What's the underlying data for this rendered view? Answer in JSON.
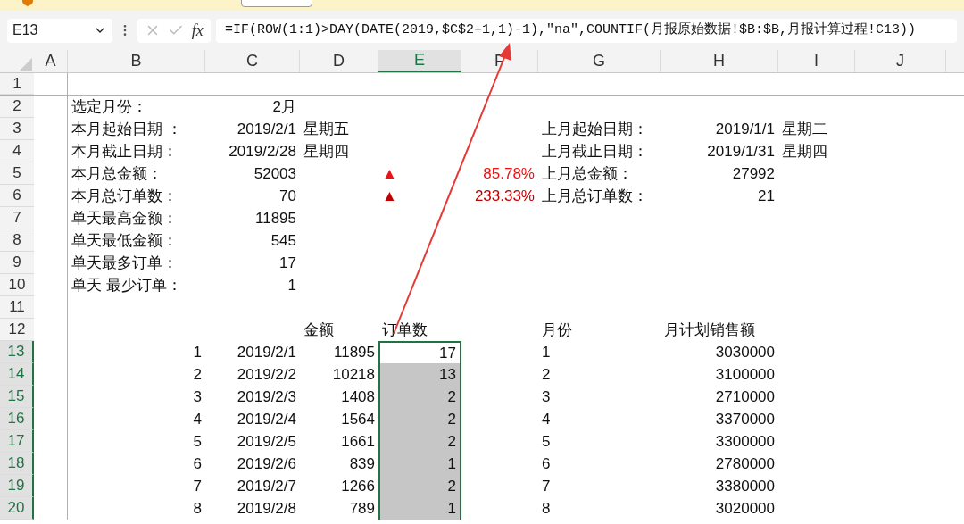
{
  "name_box": "E13",
  "fx_label": "fx",
  "formula": "=IF(ROW(1:1)>DAY(DATE(2019,$C$2+1,1)-1),\"na\",COUNTIF(月报原始数据!$B:$B,月报计算过程!C13))",
  "columns": [
    {
      "label": "A",
      "selected": false
    },
    {
      "label": "B",
      "selected": false
    },
    {
      "label": "C",
      "selected": false
    },
    {
      "label": "D",
      "selected": false
    },
    {
      "label": "E",
      "selected": true
    },
    {
      "label": "F",
      "selected": false
    },
    {
      "label": "G",
      "selected": false
    },
    {
      "label": "H",
      "selected": false
    },
    {
      "label": "I",
      "selected": false
    },
    {
      "label": "J",
      "selected": false
    }
  ],
  "row_headers": [
    {
      "label": "1",
      "selected": false
    },
    {
      "label": "2",
      "selected": false
    },
    {
      "label": "3",
      "selected": false
    },
    {
      "label": "4",
      "selected": false
    },
    {
      "label": "5",
      "selected": false
    },
    {
      "label": "6",
      "selected": false
    },
    {
      "label": "7",
      "selected": false
    },
    {
      "label": "8",
      "selected": false
    },
    {
      "label": "9",
      "selected": false
    },
    {
      "label": "10",
      "selected": false
    },
    {
      "label": "11",
      "selected": false
    },
    {
      "label": "12",
      "selected": false
    },
    {
      "label": "13",
      "selected": true
    },
    {
      "label": "14",
      "selected": true
    },
    {
      "label": "15",
      "selected": true
    },
    {
      "label": "16",
      "selected": true
    },
    {
      "label": "17",
      "selected": true
    },
    {
      "label": "18",
      "selected": true
    },
    {
      "label": "19",
      "selected": true
    },
    {
      "label": "20",
      "selected": true
    }
  ],
  "summary": [
    {
      "label": "选定月份：",
      "value": "2月"
    },
    {
      "label": "本月起始日期 ：",
      "value": "2019/2/1",
      "weekday": "星期五"
    },
    {
      "label": "本月截止日期：",
      "value": "2019/2/28",
      "weekday": "星期四"
    },
    {
      "label": "本月总金额：",
      "value": "52003"
    },
    {
      "label": "本月总订单数：",
      "value": "70"
    },
    {
      "label": "单天最高金额：",
      "value": "11895"
    },
    {
      "label": "单天最低金额：",
      "value": "545"
    },
    {
      "label": "单天最多订单：",
      "value": "17"
    },
    {
      "label": "单天 最少订单：",
      "value": "1"
    }
  ],
  "change": [
    {
      "arrow": "▲",
      "percent": "85.78%",
      "color": "#ee1111"
    },
    {
      "arrow": "▲",
      "percent": "233.33%",
      "color": "#c00000"
    }
  ],
  "previous_month": [
    {
      "label": "上月起始日期：",
      "value": "2019/1/1",
      "weekday": "星期二"
    },
    {
      "label": "上月截止日期：",
      "value": "2019/1/31",
      "weekday": "星期四"
    },
    {
      "label": "上月总金额：",
      "value": "27992"
    },
    {
      "label": "上月总订单数：",
      "value": "21"
    }
  ],
  "daily_table": {
    "columns": [
      "金额",
      "订单数"
    ],
    "rows": [
      {
        "index": "1",
        "date": "2019/2/1",
        "amount": "11895",
        "orders": "17",
        "selected": true,
        "active": true
      },
      {
        "index": "2",
        "date": "2019/2/2",
        "amount": "10218",
        "orders": "13",
        "selected": true,
        "active": false
      },
      {
        "index": "3",
        "date": "2019/2/3",
        "amount": "1408",
        "orders": "2",
        "selected": true,
        "active": false
      },
      {
        "index": "4",
        "date": "2019/2/4",
        "amount": "1564",
        "orders": "2",
        "selected": true,
        "active": false
      },
      {
        "index": "5",
        "date": "2019/2/5",
        "amount": "1661",
        "orders": "2",
        "selected": true,
        "active": false
      },
      {
        "index": "6",
        "date": "2019/2/6",
        "amount": "839",
        "orders": "1",
        "selected": true,
        "active": false
      },
      {
        "index": "7",
        "date": "2019/2/7",
        "amount": "1266",
        "orders": "2",
        "selected": true,
        "active": false
      },
      {
        "index": "8",
        "date": "2019/2/8",
        "amount": "789",
        "orders": "1",
        "selected": true,
        "active": false
      }
    ]
  },
  "plan_table": {
    "columns": [
      "月份",
      "月计划销售额"
    ],
    "rows": [
      {
        "month": "1",
        "amount": "3030000"
      },
      {
        "month": "2",
        "amount": "3100000"
      },
      {
        "month": "3",
        "amount": "2710000"
      },
      {
        "month": "4",
        "amount": "3370000"
      },
      {
        "month": "5",
        "amount": "3300000"
      },
      {
        "month": "6",
        "amount": "2780000"
      },
      {
        "month": "7",
        "amount": "3380000"
      },
      {
        "month": "8",
        "amount": "3020000"
      }
    ]
  }
}
